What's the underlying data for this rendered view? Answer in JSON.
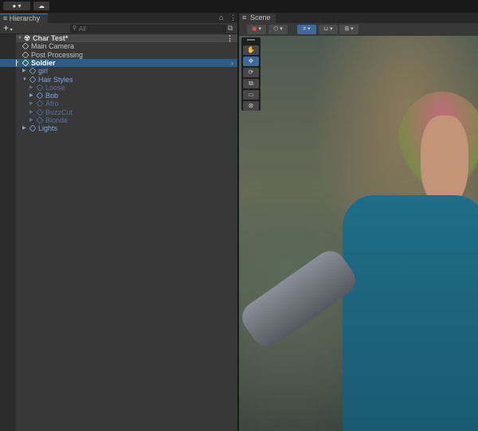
{
  "topbar": {
    "account_icon": "account-icon",
    "cloud_icon": "cloud-icon"
  },
  "hierarchy": {
    "tab": "Hierarchy",
    "add_label": "+",
    "search_placeholder": "All",
    "scene": "Char Test*",
    "items": [
      {
        "label": "Main Camera",
        "depth": 1,
        "style": "normal"
      },
      {
        "label": "Post Processing",
        "depth": 1,
        "style": "normal"
      },
      {
        "label": "Soldier",
        "depth": 1,
        "style": "selected"
      },
      {
        "label": "girl",
        "depth": 2,
        "style": "prefab"
      },
      {
        "label": "Hair Styles",
        "depth": 2,
        "style": "prefab"
      },
      {
        "label": "Loose",
        "depth": 3,
        "style": "inactive"
      },
      {
        "label": "Bob",
        "depth": 3,
        "style": "prefab"
      },
      {
        "label": "Afro",
        "depth": 3,
        "style": "inactive"
      },
      {
        "label": "BuzzCut",
        "depth": 3,
        "style": "inactive"
      },
      {
        "label": "Blonde",
        "depth": 3,
        "style": "inactive"
      },
      {
        "label": "Lights",
        "depth": 2,
        "style": "prefab"
      }
    ]
  },
  "scene_view": {
    "tab": "Scene",
    "tools": [
      "hand-tool",
      "move-tool",
      "rotate-tool",
      "scale-tool",
      "rect-tool",
      "transform-tool"
    ],
    "active_tool": "move-tool"
  },
  "colors": {
    "selection": "#2c5d87",
    "prefab": "#7ca9e6",
    "accent": "#3a79bb"
  }
}
